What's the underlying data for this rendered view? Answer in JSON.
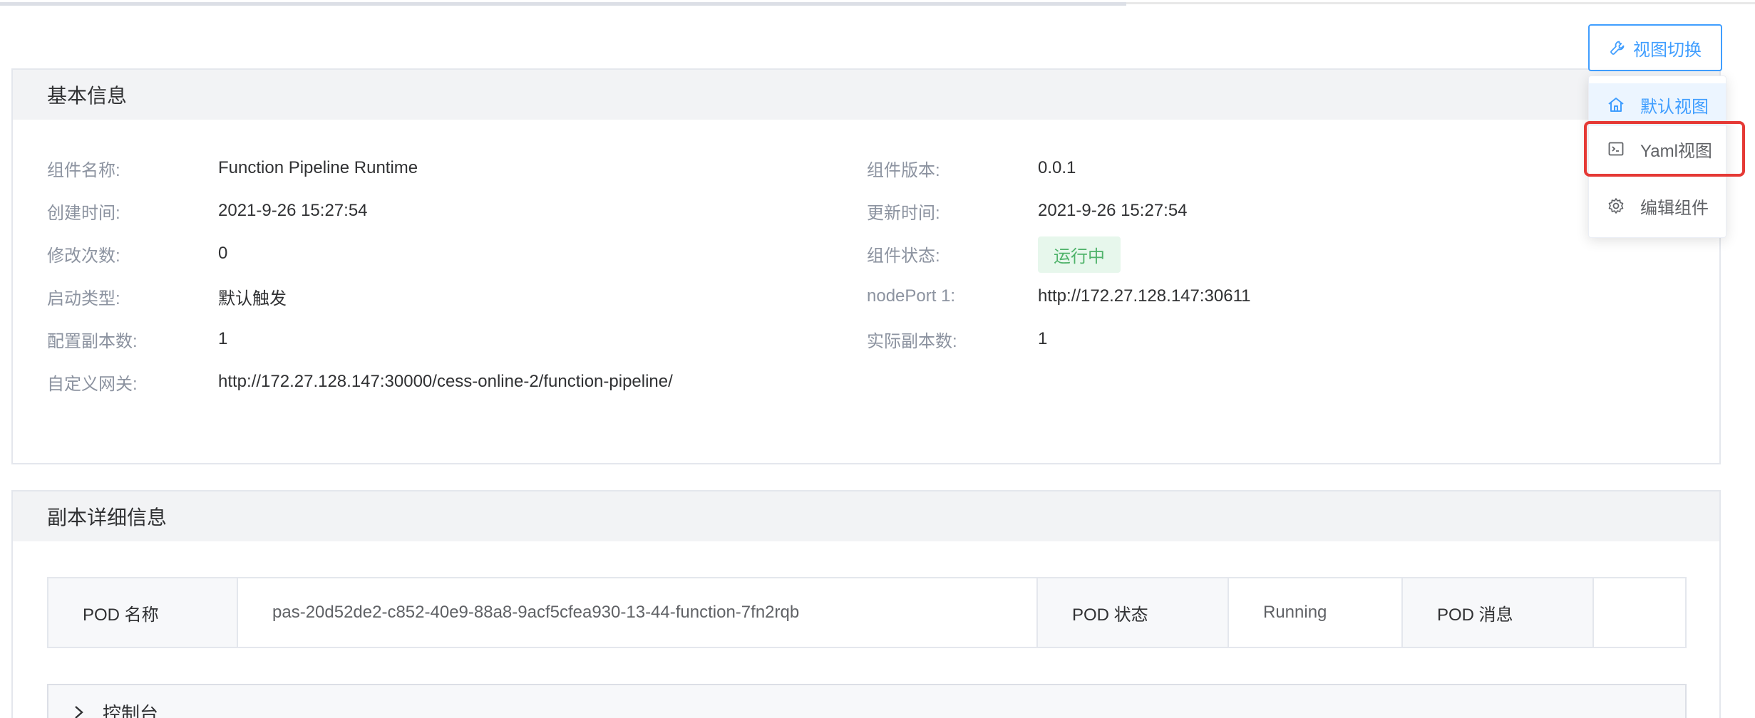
{
  "view_switch": {
    "label": "视图切换"
  },
  "dropdown": {
    "items": [
      {
        "label": "默认视图"
      },
      {
        "label": "Yaml视图"
      },
      {
        "label": "编辑组件"
      }
    ]
  },
  "basic_info": {
    "title": "基本信息",
    "rows": [
      {
        "label": "组件名称:",
        "value": "Function Pipeline Runtime"
      },
      {
        "label": "创建时间:",
        "value": "2021-9-26 15:27:54"
      },
      {
        "label": "修改次数:",
        "value": "0"
      },
      {
        "label": "启动类型:",
        "value": "默认触发"
      },
      {
        "label": "配置副本数:",
        "value": "1"
      },
      {
        "label": "自定义网关:",
        "value": "http://172.27.128.147:30000/cess-online-2/function-pipeline/"
      }
    ],
    "rows_right": [
      {
        "label": "组件版本:",
        "value": "0.0.1"
      },
      {
        "label": "更新时间:",
        "value": "2021-9-26 15:27:54"
      },
      {
        "label": "组件状态:",
        "value": "运行中"
      },
      {
        "label": "nodePort 1:",
        "value": "http://172.27.128.147:30611"
      },
      {
        "label": "实际副本数:",
        "value": "1"
      }
    ],
    "status_color": "#4fb36a"
  },
  "replica_info": {
    "title": "副本详细信息",
    "pod_name_label": "POD 名称",
    "pod_name_value": "pas-20d52de2-c852-40e9-88a8-9acf5cfea930-13-44-function-7fn2rqb",
    "pod_status_label": "POD 状态",
    "pod_status_value": "Running",
    "pod_message_label": "POD 消息",
    "pod_message_value": ""
  },
  "console": {
    "label": "控制台"
  },
  "colors": {
    "accent": "#409eff",
    "highlight": "#e53935"
  }
}
